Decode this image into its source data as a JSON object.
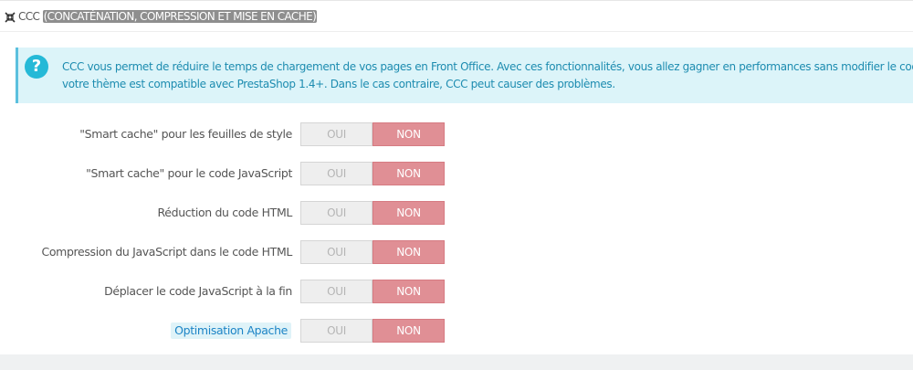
{
  "panel": {
    "title_prefix": "CCC",
    "title_sub": "(CONCATÉNATION, COMPRESSION ET MISE EN CACHE)",
    "icon": "arrows-collapse-icon"
  },
  "alert": {
    "icon": "question-icon",
    "line1": "CCC vous permet de réduire le temps de chargement de vos pages en Front Office. Avec ces fonctionnalités, vous allez gagner en performances sans modifier le code source",
    "line2": "votre thème est compatible avec PrestaShop 1.4+. Dans le cas contraire, CCC peut causer des problèmes."
  },
  "switch_labels": {
    "yes": "OUI",
    "no": "NON"
  },
  "settings": [
    {
      "label": "\"Smart cache\" pour les feuilles de style",
      "value": "NON"
    },
    {
      "label": "\"Smart cache\" pour le code JavaScript",
      "value": "NON"
    },
    {
      "label": "Réduction du code HTML",
      "value": "NON"
    },
    {
      "label": "Compression du JavaScript dans le code HTML",
      "value": "NON"
    },
    {
      "label": "Déplacer le code JavaScript à la fin",
      "value": "NON"
    },
    {
      "label": "Optimisation Apache",
      "value": "NON",
      "has_help": true
    }
  ],
  "colors": {
    "accent_info": "#25b9d7",
    "alert_bg": "#dcf4f9",
    "switch_no_active": "#e08f95",
    "switch_yes_inactive": "#eeeeee"
  }
}
